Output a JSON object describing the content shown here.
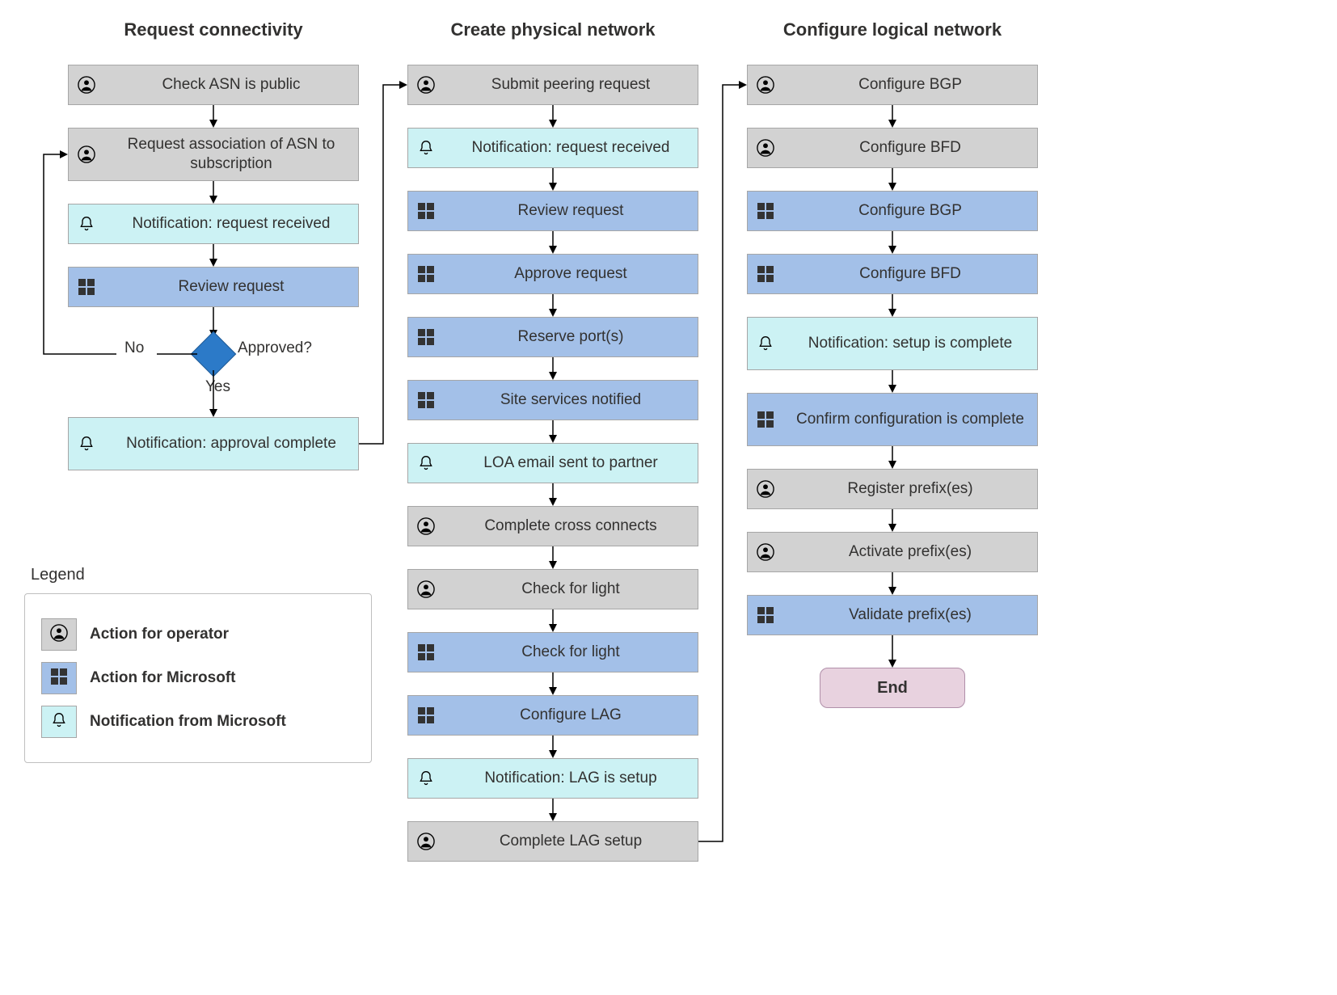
{
  "columns": {
    "c1": {
      "title": "Request connectivity"
    },
    "c2": {
      "title": "Create physical network"
    },
    "c3": {
      "title": "Configure logical network"
    }
  },
  "decision": {
    "label": "Approved?",
    "yes": "Yes",
    "no": "No"
  },
  "c1_steps": {
    "s1": "Check ASN is public",
    "s2": "Request association of ASN to subscription",
    "s3": "Notification: request received",
    "s4": "Review request",
    "s5": "Notification: approval complete"
  },
  "c2_steps": {
    "s1": "Submit peering request",
    "s2": "Notification: request received",
    "s3": "Review request",
    "s4": "Approve request",
    "s5": "Reserve port(s)",
    "s6": "Site services notified",
    "s7": "LOA email sent to partner",
    "s8": "Complete cross connects",
    "s9": "Check for light",
    "s10": "Check for light",
    "s11": "Configure LAG",
    "s12": "Notification: LAG is setup",
    "s13": "Complete LAG setup"
  },
  "c3_steps": {
    "s1": "Configure BGP",
    "s2": "Configure BFD",
    "s3": "Configure BGP",
    "s4": "Configure BFD",
    "s5": "Notification: setup is complete",
    "s6": "Confirm configuration is complete",
    "s7": "Register prefix(es)",
    "s8": "Activate prefix(es)",
    "s9": "Validate prefix(es)"
  },
  "end_label": "End",
  "legend": {
    "title": "Legend",
    "operator": "Action for operator",
    "microsoft": "Action for Microsoft",
    "notification": "Notification from Microsoft"
  },
  "colors": {
    "operator_bg": "#d2d2d2",
    "microsoft_bg": "#a3c0e8",
    "notification_bg": "#ccf2f4",
    "end_bg": "#e8d2df",
    "diamond": "#2c7ac8"
  }
}
